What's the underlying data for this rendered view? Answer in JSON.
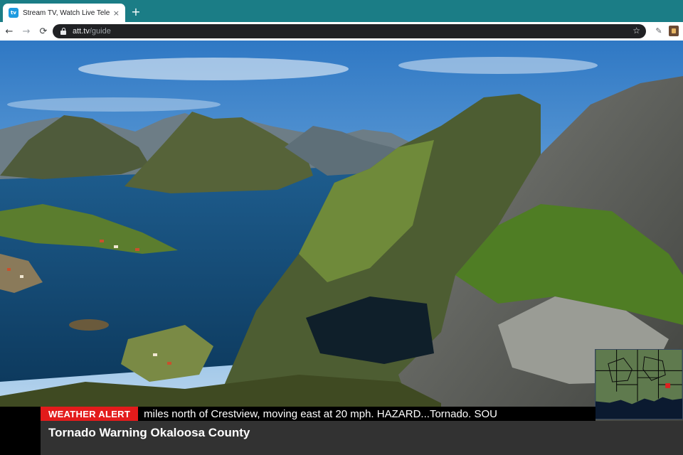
{
  "browser": {
    "tab": {
      "favicon_text": "tv",
      "title": "Stream TV, Watch Live Television",
      "close_glyph": "×"
    },
    "new_tab_glyph": "+",
    "nav": {
      "back_glyph": "←",
      "forward_glyph": "→",
      "reload_glyph": "⟳"
    },
    "address": {
      "host": "att.tv",
      "path": "/guide"
    },
    "star_glyph": "☆",
    "extension_glyph": "✎"
  },
  "broadcast": {
    "alert_label": "WEATHER ALERT",
    "crawl_text": "miles north of Crestview, moving east at 20 mph. HAZARD...Tornado. SOU",
    "headline": "Tornado Warning Okaloosa County"
  },
  "colors": {
    "tabstrip": "#1b7d86",
    "alert_red": "#e31b1b",
    "headline_bg": "#323232",
    "map_marker": "#e02020"
  }
}
